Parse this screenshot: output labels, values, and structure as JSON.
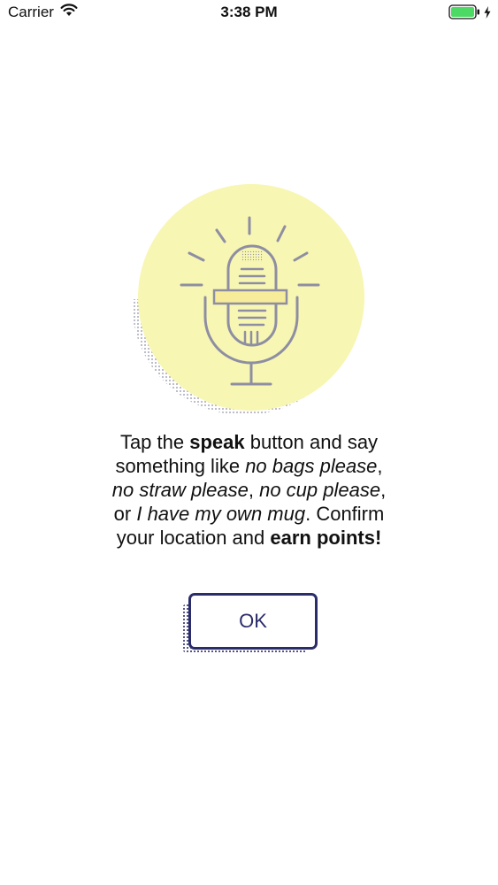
{
  "status_bar": {
    "carrier": "Carrier",
    "time": "3:38 PM",
    "icons": {
      "wifi": "wifi-icon",
      "battery": "battery-icon",
      "charging": "charging-bolt-icon"
    },
    "battery_color": "#4cd964"
  },
  "illustration": {
    "icon": "microphone-icon",
    "circle_color": "#f8f6b3",
    "line_color": "#8e8ea3"
  },
  "message": {
    "part1": "Tap the ",
    "speak": "speak",
    "part2": " button and say something like ",
    "ex1": "no bags please",
    "sep1": ", ",
    "ex2": "no straw please",
    "sep2": ", ",
    "ex3": "no cup please",
    "sep3": ", or ",
    "ex4": "I have my own mug",
    "part3": ". Confirm your location and ",
    "earn": "earn points!"
  },
  "ok_button": {
    "label": "OK",
    "color": "#2b2d6b"
  }
}
